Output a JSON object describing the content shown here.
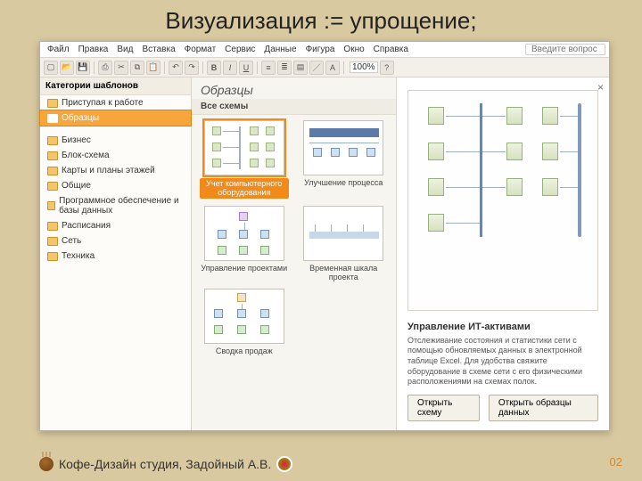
{
  "slide": {
    "title": "Визуализация := упрощение;",
    "footer": "Кофе-Дизайн студия, Задойный А.В.",
    "page_number": "02"
  },
  "menu": [
    "Файл",
    "Правка",
    "Вид",
    "Вставка",
    "Формат",
    "Сервис",
    "Данные",
    "Фигура",
    "Окно",
    "Справка"
  ],
  "help_placeholder": "Введите вопрос",
  "toolbar": {
    "zoom": "100%"
  },
  "sidebar": {
    "heading": "Категории шаблонов",
    "top": [
      "Приступая к работе",
      "Образцы"
    ],
    "active_index": 1,
    "groups": [
      "Бизнес",
      "Блок-схема",
      "Карты и планы этажей",
      "Общие",
      "Программное обеспечение и базы данных",
      "Расписания",
      "Сеть",
      "Техника"
    ]
  },
  "middle": {
    "title": "Образцы",
    "subhead": "Все схемы",
    "templates": [
      "Учет компьютерного оборудования",
      "Улучшение процесса",
      "Управление проектами",
      "Временная шкала проекта",
      "Сводка продаж"
    ],
    "selected_index": 0
  },
  "detail": {
    "title": "Управление ИТ-активами",
    "desc": "Отслеживание состояния и статистики сети с помощью обновляемых данных в электронной таблице Excel. Для удобства свяжите оборудование в схеме сети с его физическими расположениями на схемах полок.",
    "btn_open": "Открыть схему",
    "btn_data": "Открыть образцы данных"
  }
}
